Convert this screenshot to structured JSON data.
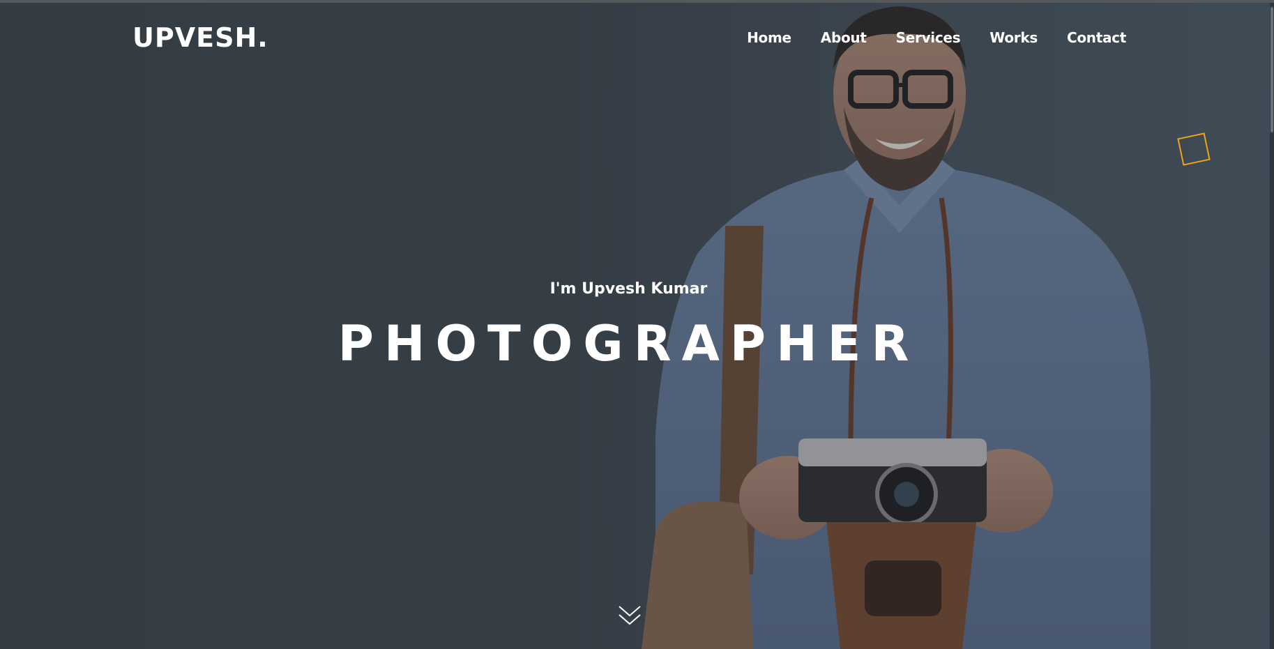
{
  "brand": {
    "logo_text": "UPVESH."
  },
  "nav": {
    "items": [
      {
        "label": "Home"
      },
      {
        "label": "About"
      },
      {
        "label": "Services"
      },
      {
        "label": "Works"
      },
      {
        "label": "Contact"
      }
    ]
  },
  "hero": {
    "intro": "I'm Upvesh Kumar",
    "headline": "PHOTOGRAPHER",
    "scroll_icon": "chevron-double-down-icon",
    "decor_icon": "outline-square-icon"
  },
  "colors": {
    "accent": "#f0a21a",
    "overlay": "#3b444c",
    "text": "#ffffff"
  }
}
